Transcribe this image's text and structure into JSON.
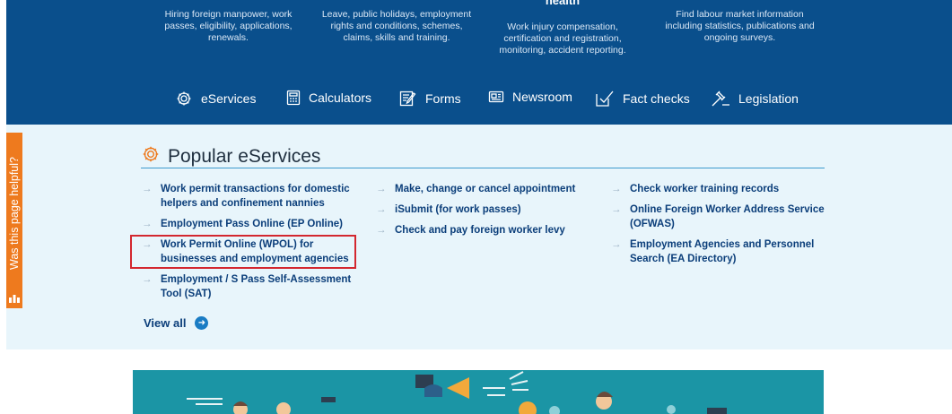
{
  "header_columns": [
    {
      "text_lines": [
        "Hiring foreign manpower, work",
        "passes, eligibility, applications,",
        "renewals."
      ]
    },
    {
      "text_lines": [
        "Leave, public holidays, employment",
        "rights and conditions, schemes,",
        "claims, skills and training."
      ]
    },
    {
      "heading": "health",
      "text_lines": [
        "Work injury compensation,",
        "certification and registration,",
        "monitoring, accident reporting."
      ]
    },
    {
      "text_lines": [
        "Find labour market information",
        "including statistics, publications and",
        "ongoing surveys."
      ]
    }
  ],
  "nav_tabs": [
    {
      "label": "eServices",
      "icon": "gear-icon"
    },
    {
      "label": "Calculators",
      "icon": "calculator-icon"
    },
    {
      "label": "Forms",
      "icon": "form-pen-icon"
    },
    {
      "label": "Newsroom",
      "icon": "newspaper-icon"
    },
    {
      "label": "Fact checks",
      "icon": "checkbox-icon"
    },
    {
      "label": "Legislation",
      "icon": "gavel-icon"
    }
  ],
  "feedback_tab": {
    "label": "Was this page helpful?",
    "icon": "rating-icon"
  },
  "popular": {
    "title": "Popular eServices",
    "icon": "gear-icon",
    "columns": [
      [
        "Work permit transactions for domestic helpers and confinement nannies",
        "Employment Pass Online (EP Online)",
        "Work Permit Online (WPOL) for businesses and employment agencies",
        "Employment / S Pass Self-Assessment Tool (SAT)"
      ],
      [
        "Make, change or cancel appointment",
        "iSubmit (for work passes)",
        "Check and pay foreign worker levy"
      ],
      [
        "Check worker training records",
        "Online Foreign Worker Address Service (OFWAS)",
        "Employment Agencies and Personnel Search (EA Directory)"
      ]
    ],
    "highlighted_item": "Work Permit Online (WPOL) for businesses and employment agencies",
    "view_all": "View all"
  },
  "colors": {
    "header_blue": "#0a4f8c",
    "panel_bg": "#e8f5fb",
    "link_blue": "#0b3e7a",
    "highlight_red": "#d3272f",
    "feedback_orange": "#ee7a1e",
    "banner_teal": "#1b95a5"
  }
}
